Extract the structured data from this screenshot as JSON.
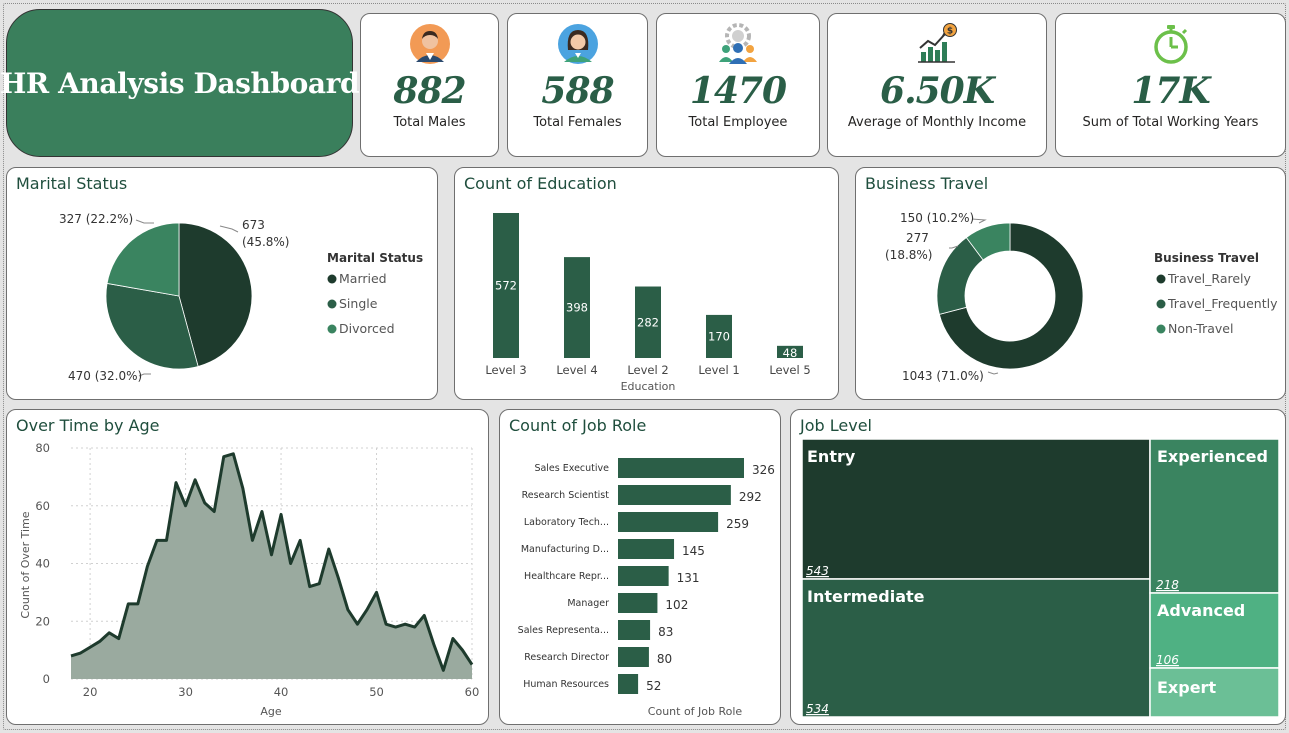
{
  "header": {
    "title": "HR Analysis Dashboard"
  },
  "kpis": [
    {
      "value": "882",
      "label": "Total Males",
      "icon": "male-avatar-icon"
    },
    {
      "value": "588",
      "label": "Total Females",
      "icon": "female-avatar-icon"
    },
    {
      "value": "1470",
      "label": "Total Employee",
      "icon": "team-gear-icon"
    },
    {
      "value": "6.50K",
      "label": "Average of Monthly Income",
      "icon": "income-growth-icon"
    },
    {
      "value": "17K",
      "label": "Sum of Total Working Years",
      "icon": "stopwatch-icon"
    }
  ],
  "colors": {
    "dark": "#1e3b2d",
    "mid": "#2b5e47",
    "green": "#3a8460",
    "light": "#4fb183",
    "lighter": "#6bbf96",
    "area_fill": "#9aaa9f",
    "area_line": "#1e3b2d"
  },
  "chart_data": [
    {
      "id": "marital",
      "type": "pie",
      "title": "Marital Status",
      "legend_title": "Marital Status",
      "legend_position": "right",
      "slices": [
        {
          "name": "Married",
          "value": 673,
          "label": "673 (45.8%)"
        },
        {
          "name": "Single",
          "value": 470,
          "label": "470 (32.0%)"
        },
        {
          "name": "Divorced",
          "value": 327,
          "label": "327 (22.2%)"
        }
      ]
    },
    {
      "id": "education",
      "type": "bar",
      "title": "Count of Education",
      "xlabel": "Education",
      "categories": [
        "Level 3",
        "Level 4",
        "Level 2",
        "Level 1",
        "Level 5"
      ],
      "values": [
        572,
        398,
        282,
        170,
        48
      ],
      "ylim": [
        0,
        572
      ]
    },
    {
      "id": "travel",
      "type": "pie",
      "subtype": "donut",
      "title": "Business Travel",
      "legend_title": "Business Travel",
      "legend_position": "right",
      "slices": [
        {
          "name": "Travel_Rarely",
          "value": 1043,
          "label": "1043 (71.0%)"
        },
        {
          "name": "Travel_Frequently",
          "value": 277,
          "label_line1": "277",
          "label_line2": "(18.8%)"
        },
        {
          "name": "Non-Travel",
          "value": 150,
          "label": "150 (10.2%)"
        }
      ]
    },
    {
      "id": "overtime",
      "type": "area",
      "title": "Over Time by Age",
      "xlabel": "Age",
      "ylabel": "Count of Over Time",
      "xlim": [
        18,
        60
      ],
      "ylim": [
        0,
        80
      ],
      "xticks": [
        20,
        30,
        40,
        50,
        60
      ],
      "yticks": [
        0,
        20,
        40,
        60,
        80
      ],
      "grid": true,
      "x": [
        18,
        19,
        20,
        21,
        22,
        23,
        24,
        25,
        26,
        27,
        28,
        29,
        30,
        31,
        32,
        33,
        34,
        35,
        36,
        37,
        38,
        39,
        40,
        41,
        42,
        43,
        44,
        45,
        46,
        47,
        48,
        49,
        50,
        51,
        52,
        53,
        54,
        55,
        56,
        57,
        58,
        59,
        60
      ],
      "y": [
        8,
        9,
        11,
        13,
        16,
        14,
        26,
        26,
        39,
        48,
        48,
        68,
        60,
        69,
        61,
        58,
        77,
        78,
        66,
        48,
        58,
        43,
        57,
        40,
        48,
        32,
        33,
        45,
        35,
        24,
        19,
        24,
        30,
        19,
        18,
        19,
        18,
        22,
        12,
        3,
        14,
        10,
        5
      ]
    },
    {
      "id": "jobrole",
      "type": "bar",
      "orientation": "horizontal",
      "title": "Count of Job Role",
      "xlabel": "Count of Job Role",
      "categories": [
        "Sales Executive",
        "Research Scientist",
        "Laboratory Tech...",
        "Manufacturing D...",
        "Healthcare Repr...",
        "Manager",
        "Sales Representa...",
        "Research Director",
        "Human Resources"
      ],
      "values": [
        326,
        292,
        259,
        145,
        131,
        102,
        83,
        80,
        52
      ],
      "xlim": [
        0,
        326
      ]
    },
    {
      "id": "joblevel",
      "type": "treemap",
      "title": "Job Level",
      "items": [
        {
          "name": "Entry",
          "value": 543
        },
        {
          "name": "Intermediate",
          "value": 534
        },
        {
          "name": "Experienced",
          "value": 218
        },
        {
          "name": "Advanced",
          "value": 106
        },
        {
          "name": "Expert",
          "value": ""
        }
      ]
    }
  ]
}
